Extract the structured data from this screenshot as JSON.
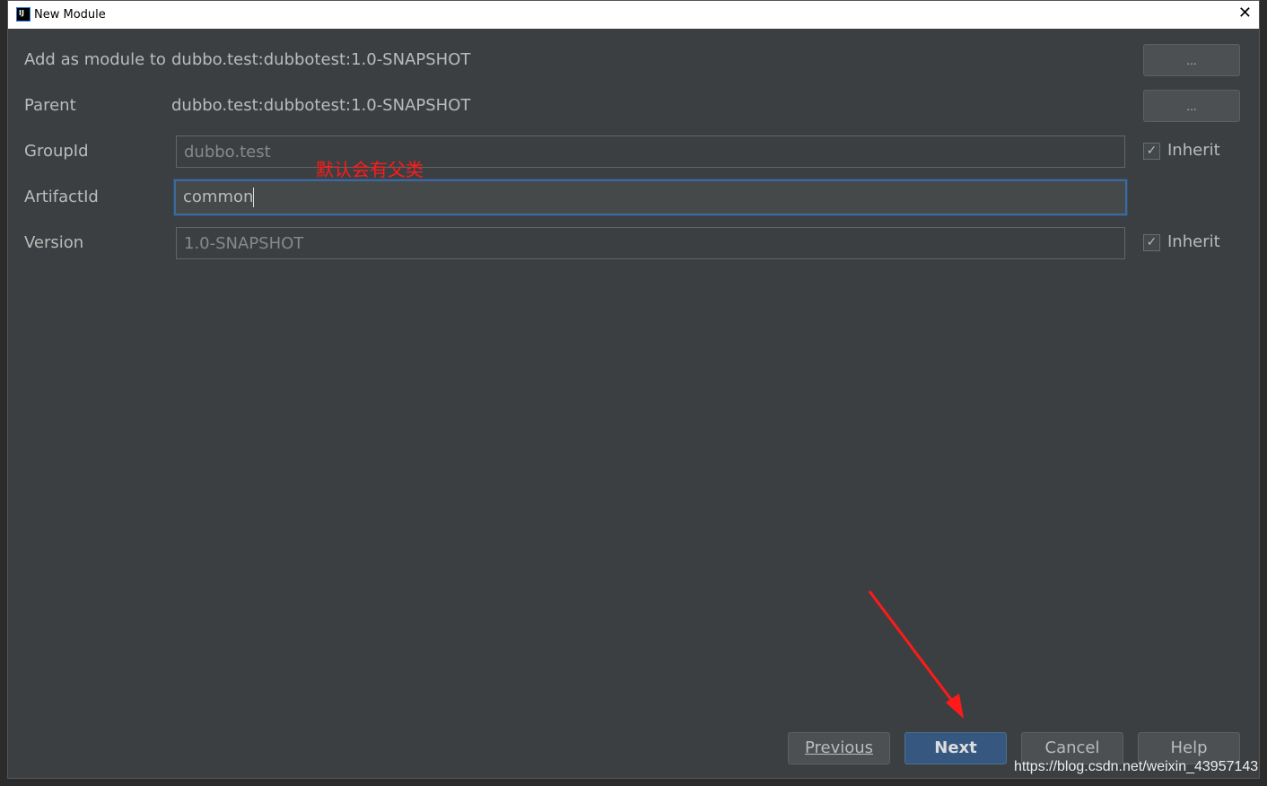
{
  "window": {
    "title": "New Module",
    "icon_text": "IJ"
  },
  "form": {
    "add_as_module_label": "Add as module to",
    "add_as_module_value": "dubbo.test:dubbotest:1.0-SNAPSHOT",
    "parent_label": "Parent",
    "parent_value": "dubbo.test:dubbotest:1.0-SNAPSHOT",
    "groupid_label": "GroupId",
    "groupid_value": "dubbo.test",
    "artifactid_label": "ArtifactId",
    "artifactid_value": "common",
    "version_label": "Version",
    "version_value": "1.0-SNAPSHOT",
    "browse_label": "...",
    "inherit_label": "Inherit",
    "groupid_inherit": true,
    "version_inherit": true
  },
  "annotation": {
    "note": "默认会有父类",
    "color": "#ff1a1a"
  },
  "buttons": {
    "previous": "Previous",
    "next": "Next",
    "cancel": "Cancel",
    "help": "Help"
  },
  "watermark": "https://blog.csdn.net/weixin_43957143"
}
